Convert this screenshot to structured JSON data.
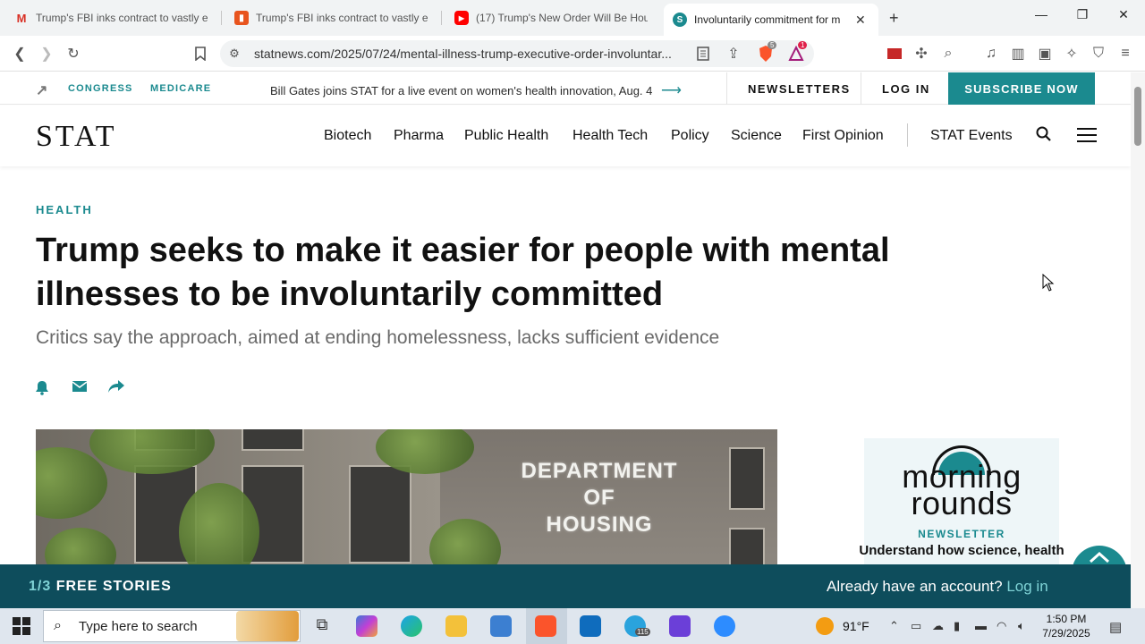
{
  "browser": {
    "tabs": [
      {
        "title": "Trump's FBI inks contract to vastly ex",
        "icon": "gmail-icon",
        "color": "#d93025"
      },
      {
        "title": "Trump's FBI inks contract to vastly ex",
        "icon": "bookmark-app-icon",
        "color": "#e8541e"
      },
      {
        "title": "(17) Trump's New Order Will Be Hous",
        "icon": "youtube-icon",
        "color": "#ff0000"
      },
      {
        "title": "Involuntarily commitment for m",
        "icon": "stat-favicon",
        "color": "#1b8a8f",
        "active": true
      }
    ],
    "url": "statnews.com/2025/07/24/mental-illness-trump-executive-order-involuntar...",
    "brave_badge": "5",
    "rewards_badge": "1"
  },
  "strip": {
    "tags": [
      "CONGRESS",
      "MEDICARE"
    ],
    "promo": "Bill Gates joins STAT for a live event on women's health innovation, Aug. 4",
    "newsletters": "NEWSLETTERS",
    "login": "LOG IN",
    "subscribe": "SUBSCRIBE NOW"
  },
  "nav": {
    "logo": "STAT",
    "items": [
      "Biotech",
      "Pharma",
      "Public Health",
      "Health Tech",
      "Policy",
      "Science",
      "First Opinion"
    ],
    "events": "STAT Events"
  },
  "article": {
    "section": "HEALTH",
    "headline": "Trump seeks to make it easier for people with mental illnesses to be involuntarily committed",
    "dek": "Critics say the approach, aimed at ending homelessness, lacks sufficient evidence",
    "image_sign": [
      "DEPARTMENT",
      "OF",
      "HOUSING"
    ]
  },
  "newsletter": {
    "logo_line1": "morning",
    "logo_line2": "rounds",
    "tag": "NEWSLETTER",
    "desc": "Understand how science, health"
  },
  "storybar": {
    "count": "1/3",
    "label": "FREE STORIES",
    "account_q": "Already have an account?",
    "login": "Log in"
  },
  "taskbar": {
    "search_placeholder": "Type here to search",
    "weather": "91°F",
    "time": "1:50 PM",
    "date": "7/29/2025",
    "telegram_badge": "115"
  },
  "colors": {
    "accent": "#1b8a8f",
    "footer": "#0e4d5c"
  }
}
